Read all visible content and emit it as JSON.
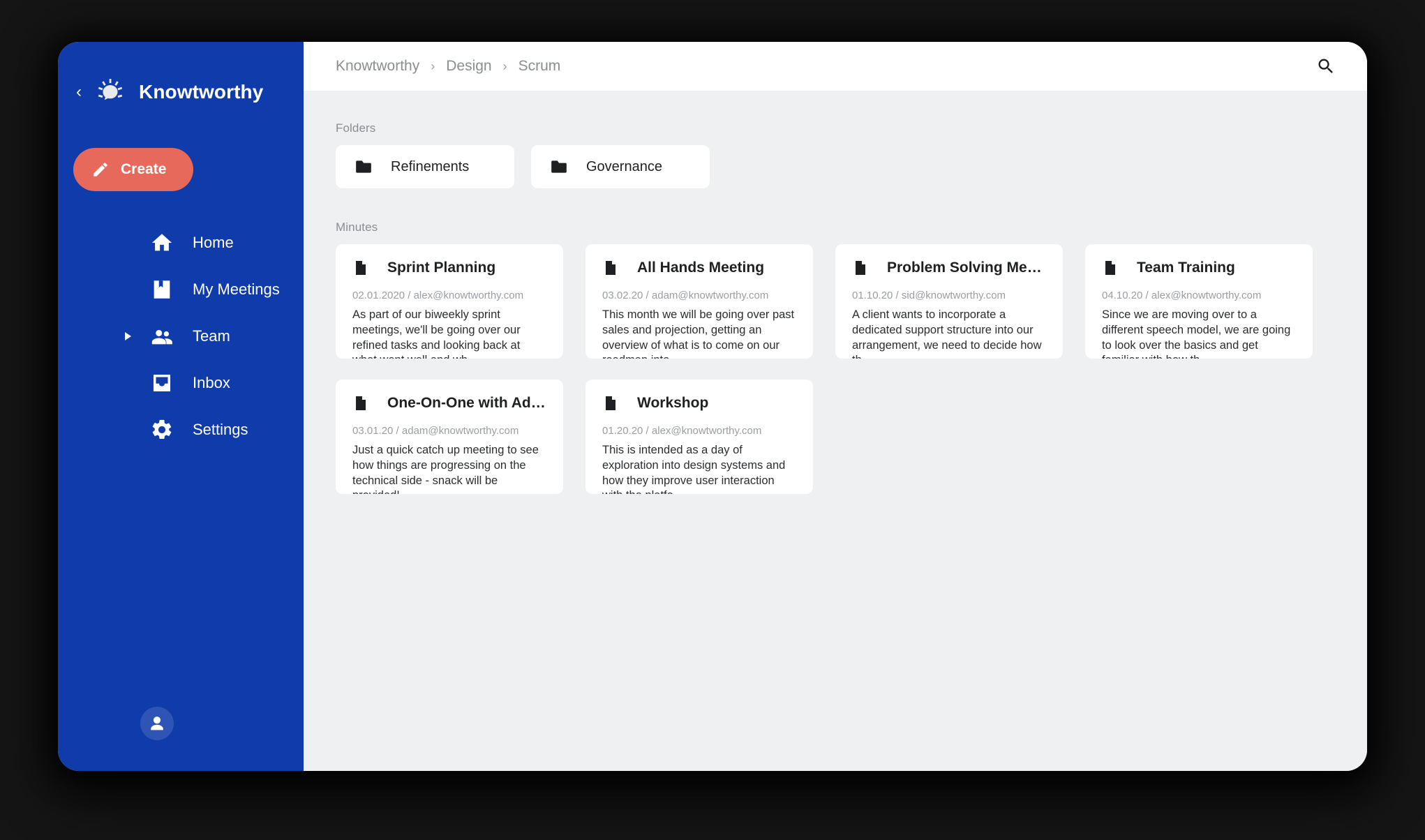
{
  "window": {
    "accent_blue": "#0f3bab",
    "accent_coral": "#e7695c",
    "content_bg": "#eff0f2"
  },
  "sidebar": {
    "back_glyph": "‹",
    "brand_name": "Knowtworthy",
    "create_label": "Create",
    "items": [
      {
        "label": "Home",
        "icon": "home-icon",
        "has_caret": false
      },
      {
        "label": "My Meetings",
        "icon": "bookmark-icon",
        "has_caret": false
      },
      {
        "label": "Team",
        "icon": "people-icon",
        "has_caret": true
      },
      {
        "label": "Inbox",
        "icon": "inbox-icon",
        "has_caret": false
      },
      {
        "label": "Settings",
        "icon": "gear-icon",
        "has_caret": false
      }
    ],
    "avatar_icon": "account-circle-icon"
  },
  "topbar": {
    "breadcrumb": [
      "Knowtworthy",
      "Design",
      "Scrum"
    ],
    "separator": "›",
    "search_icon": "search-icon"
  },
  "content": {
    "folders_label": "Folders",
    "folders": [
      {
        "name": "Refinements",
        "icon": "folder-icon"
      },
      {
        "name": "Governance",
        "icon": "folder-icon"
      }
    ],
    "minutes_label": "Minutes",
    "minutes": [
      {
        "title": "Sprint Planning",
        "meta": "02.01.2020 / alex@knowtworthy.com",
        "snippet": "As part of our biweekly sprint meetings, we'll be going over our refined tasks and looking back at what went well and wh..",
        "icon": "document-icon"
      },
      {
        "title": "All Hands Meeting",
        "meta": "03.02.20 / adam@knowtworthy.com",
        "snippet": "This month we will be going over past sales and projection, getting an overview of what is to come on our roadmap into..",
        "icon": "document-icon"
      },
      {
        "title": "Problem Solving Meeting",
        "meta": "01.10.20 / sid@knowtworthy.com",
        "snippet": "A client wants to incorporate a dedicated support structure into our arrangement, we need to decide how th..",
        "icon": "document-icon"
      },
      {
        "title": "Team Training",
        "meta": "04.10.20 / alex@knowtworthy.com",
        "snippet": "Since we are moving over to a different speech model, we are going to look over the basics and get familiar with how th..",
        "icon": "document-icon"
      },
      {
        "title": "One-On-One with Adam",
        "meta": "03.01.20 / adam@knowtworthy.com",
        "snippet": "Just a quick catch up meeting to see how things are progressing on the technical side - snack will be provided!",
        "icon": "document-icon"
      },
      {
        "title": "Workshop",
        "meta": "01.20.20 / alex@knowtworthy.com",
        "snippet": "This is intended as a day of exploration into design systems and how they improve user interaction with the platfo..",
        "icon": "document-icon"
      }
    ]
  }
}
